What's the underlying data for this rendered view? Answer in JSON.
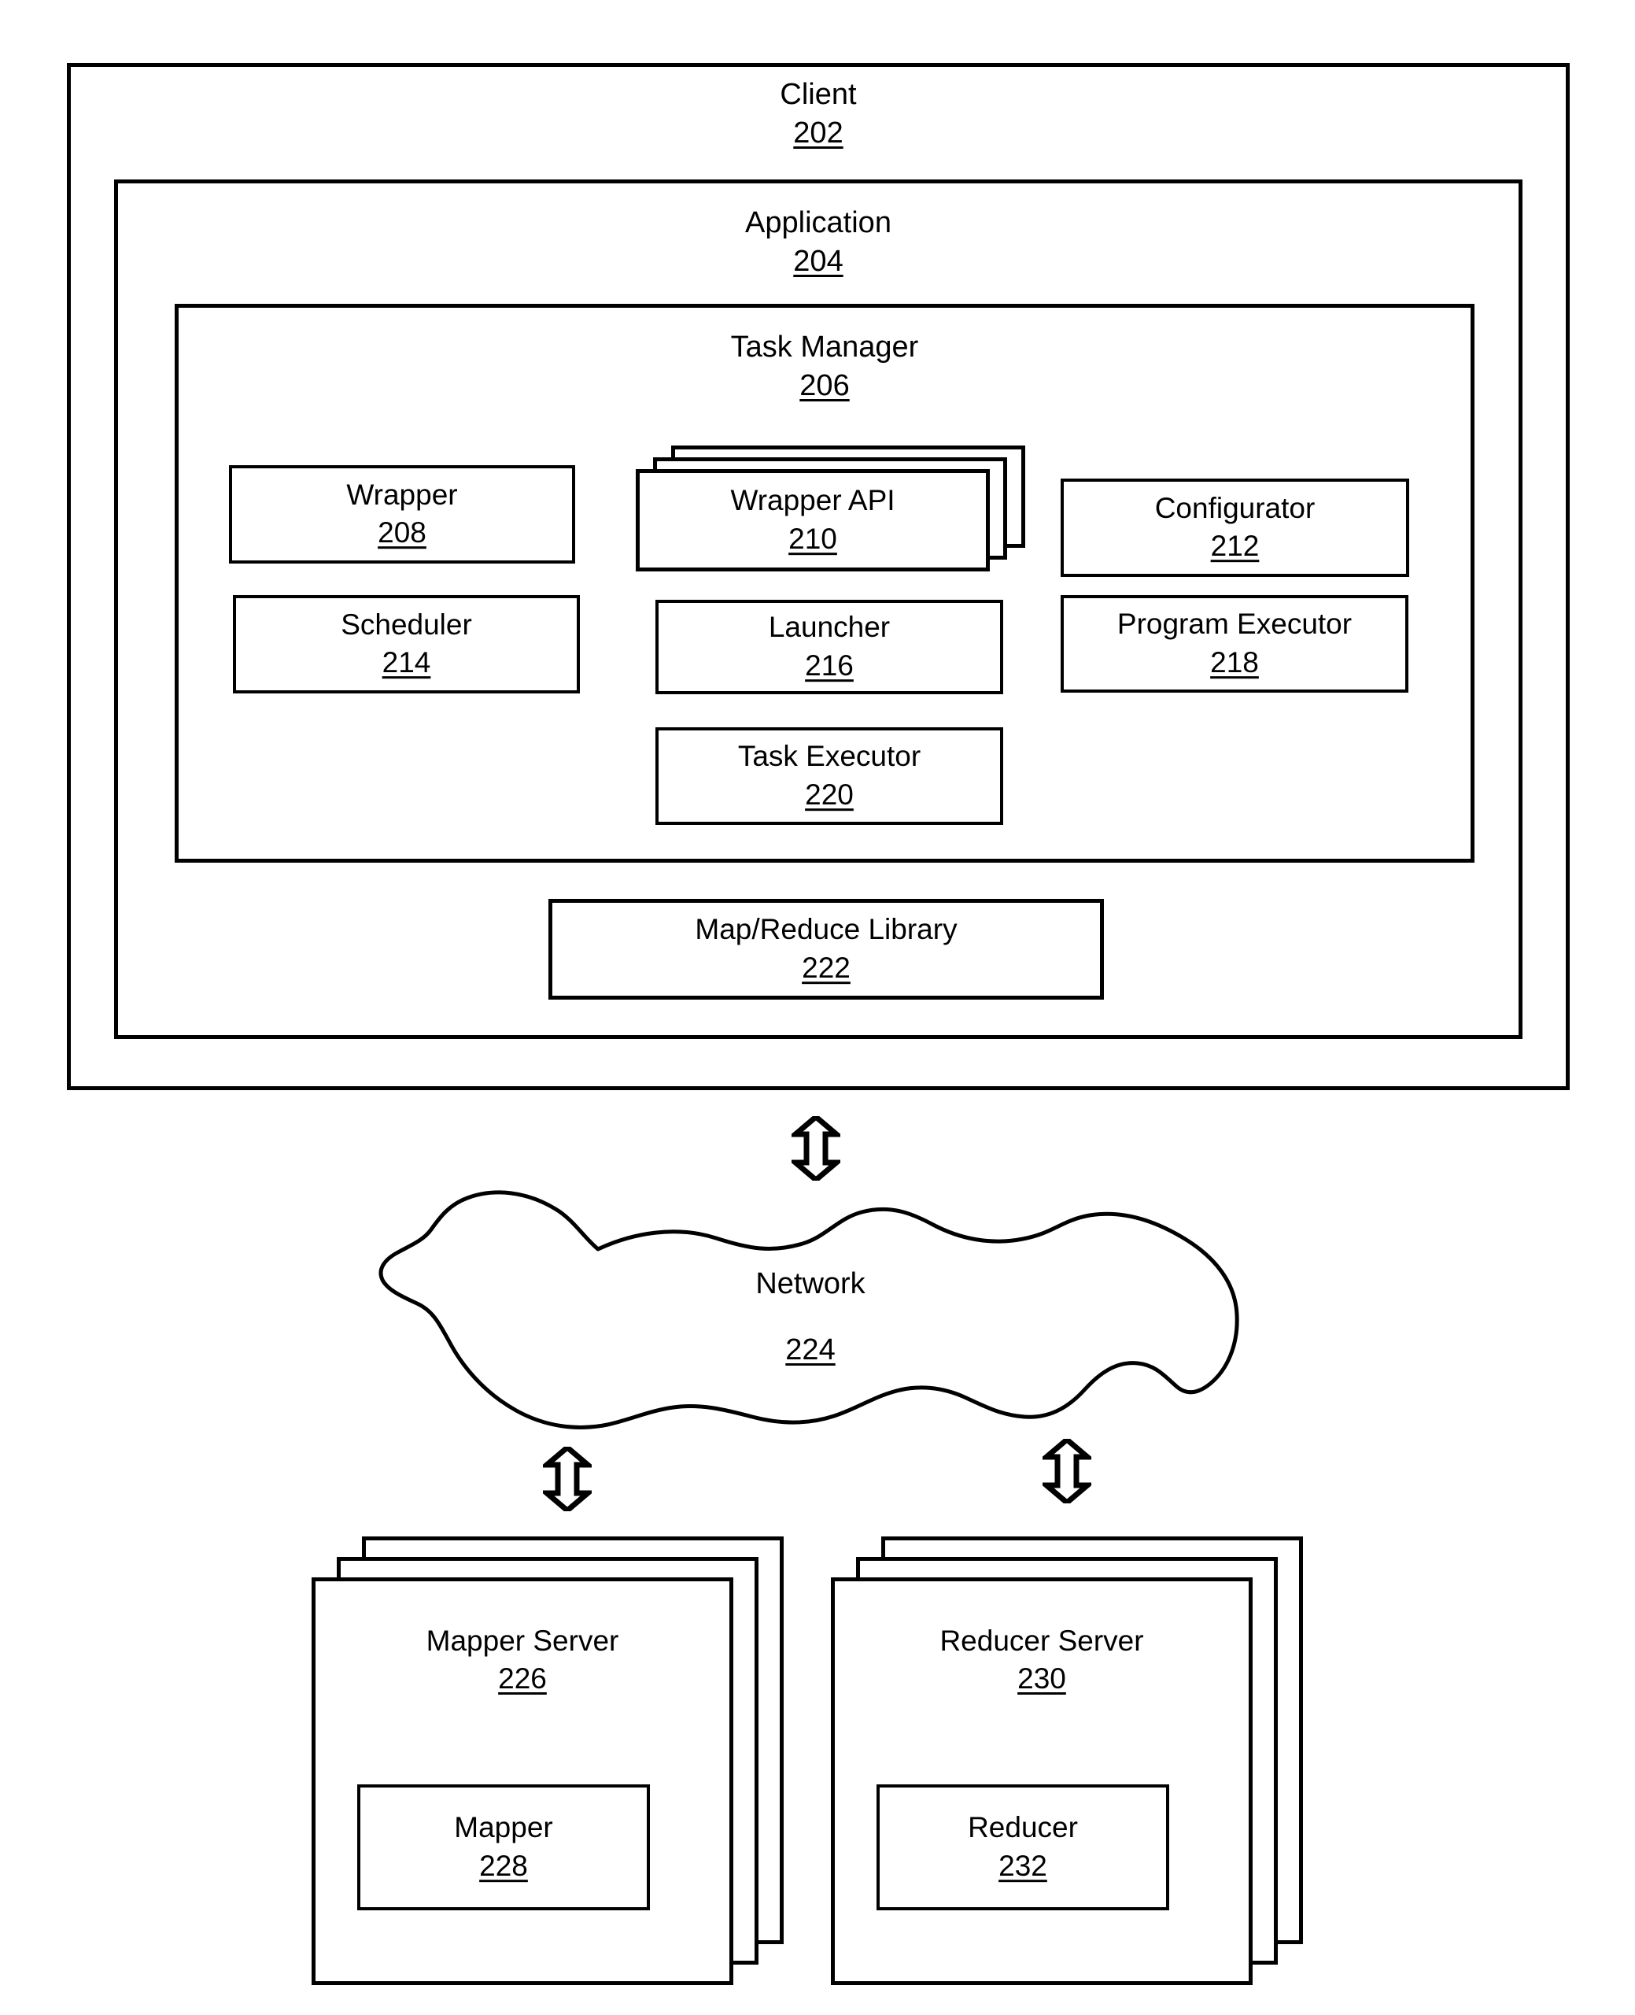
{
  "figure": {
    "type": "patent-block-diagram",
    "background_color": "#ffffff",
    "line_color": "#000000"
  },
  "client": {
    "title": "Client",
    "ref": "202"
  },
  "application": {
    "title": "Application",
    "ref": "204"
  },
  "task_manager": {
    "title": "Task Manager",
    "ref": "206",
    "components": [
      {
        "title": "Wrapper",
        "ref": "208",
        "stacked": false
      },
      {
        "title": "Wrapper API",
        "ref": "210",
        "stacked": true
      },
      {
        "title": "Configurator",
        "ref": "212",
        "stacked": false
      },
      {
        "title": "Scheduler",
        "ref": "214",
        "stacked": false
      },
      {
        "title": "Launcher",
        "ref": "216",
        "stacked": false
      },
      {
        "title": "Program Executor",
        "ref": "218",
        "stacked": false
      },
      {
        "title": "Task Executor",
        "ref": "220",
        "stacked": false
      }
    ]
  },
  "map_reduce_library": {
    "title": "Map/Reduce Library",
    "ref": "222"
  },
  "network": {
    "title": "Network",
    "ref": "224"
  },
  "mapper_server": {
    "title": "Mapper Server",
    "ref": "226",
    "stacked": true,
    "inner": {
      "title": "Mapper",
      "ref": "228"
    }
  },
  "reducer_server": {
    "title": "Reducer Server",
    "ref": "230",
    "stacked": true,
    "inner": {
      "title": "Reducer",
      "ref": "232"
    }
  },
  "connectors": [
    {
      "name": "client-to-network",
      "icon": "double-headed-vertical-arrow"
    },
    {
      "name": "network-to-mapper-server",
      "icon": "double-headed-vertical-arrow"
    },
    {
      "name": "network-to-reducer-server",
      "icon": "double-headed-vertical-arrow"
    }
  ]
}
